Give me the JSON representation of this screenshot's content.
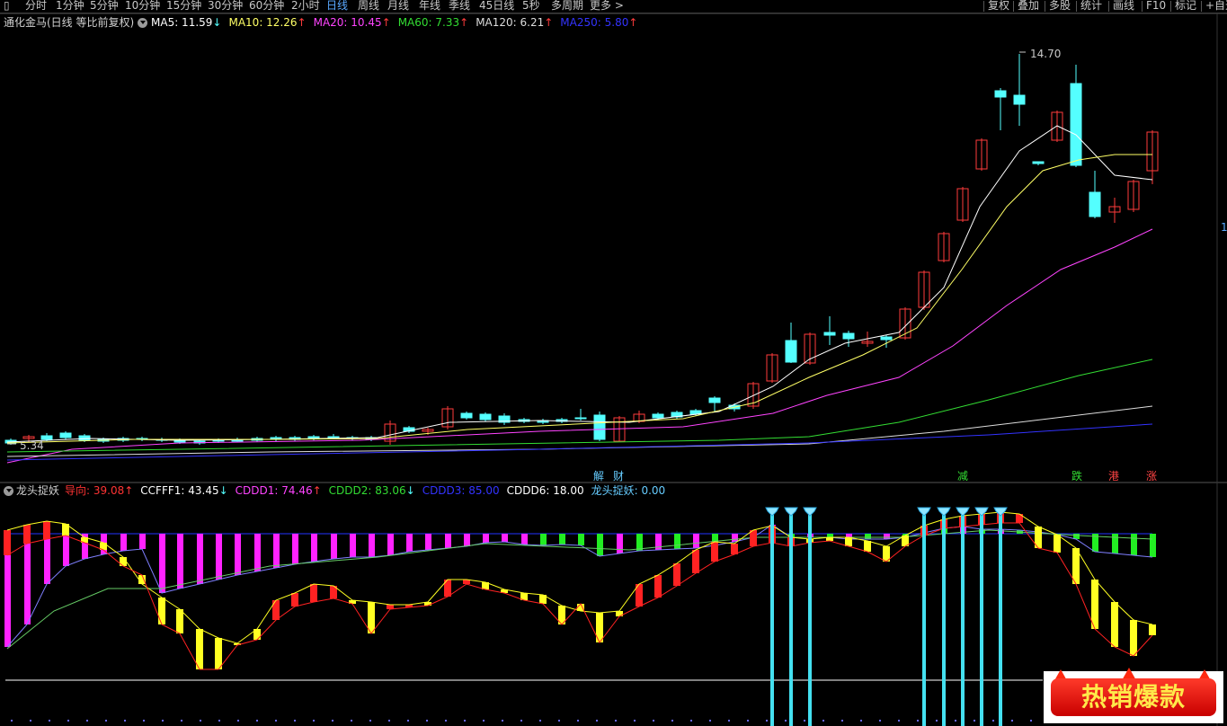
{
  "toolbar": {
    "left_items": [
      "分时",
      "1分钟",
      "5分钟",
      "10分钟",
      "15分钟",
      "30分钟",
      "60分钟",
      "2小时",
      "日线",
      "周线",
      "月线",
      "年线",
      "季线",
      "45日线",
      "5秒",
      "多周期",
      "更多 >"
    ],
    "active_item": "日线",
    "right_items": [
      "复权",
      "叠加",
      "多股",
      "统计",
      "画线",
      "F10",
      "标记",
      "+自选"
    ]
  },
  "main_legend": {
    "title": "通化金马(日线 等比前复权)",
    "ma": [
      {
        "label": "MA5: 11.59",
        "arrow": "↓",
        "color": "#ffffff"
      },
      {
        "label": "MA10: 12.26",
        "arrow": "↑",
        "color": "#ffff66"
      },
      {
        "label": "MA20: 10.45",
        "arrow": "↑",
        "color": "#ff44ff"
      },
      {
        "label": "MA60: 7.33",
        "arrow": "↑",
        "color": "#33dd33"
      },
      {
        "label": "MA120: 6.21",
        "arrow": "↑",
        "color": "#dddddd"
      },
      {
        "label": "MA250: 5.80",
        "arrow": "↑",
        "color": "#3333ff"
      }
    ]
  },
  "price_labels": {
    "high": "14.70",
    "low": "5.34",
    "right_edge": "1"
  },
  "signals_main": [
    {
      "text": "解",
      "color": "#66ccff"
    },
    {
      "text": "财",
      "color": "#66ccff"
    },
    {
      "text": "减",
      "color": "#33dd33"
    },
    {
      "text": "跌",
      "color": "#33dd33"
    },
    {
      "text": "港",
      "color": "#ff4444"
    },
    {
      "text": "涨",
      "color": "#ff4444"
    }
  ],
  "indicator_legend": {
    "title": "龙头捉妖",
    "items": [
      {
        "label": "导向: 39.08",
        "arrow": "↑",
        "color": "#ff3333"
      },
      {
        "label": "CCFFF1: 43.45",
        "arrow": "↓",
        "color": "#ffffff"
      },
      {
        "label": "CDDD1: 74.46",
        "arrow": "↑",
        "color": "#ff44ff"
      },
      {
        "label": "CDDD2: 83.06",
        "arrow": "↓",
        "color": "#33dd33"
      },
      {
        "label": "CDDD3: 85.00",
        "arrow": "",
        "color": "#3333ff"
      },
      {
        "label": "CDDD6: 18.00",
        "arrow": "",
        "color": "#ffffff"
      },
      {
        "label": "龙头捉妖: 0.00",
        "arrow": "",
        "color": "#66ccff"
      }
    ]
  },
  "promo": {
    "text": "热销爆款"
  },
  "colors": {
    "up": "#ff3b3b",
    "down": "#54ffff",
    "ma5": "#ffffff",
    "ma10": "#ffff66",
    "ma20": "#ff44ff",
    "ma60": "#33dd33",
    "ma120": "#dddddd",
    "ma250": "#3333ff",
    "magenta": "#ff22ff",
    "yellow": "#ffff22",
    "green": "#22ee22",
    "red": "#ff2222",
    "cyan": "#44e0f0"
  }
}
